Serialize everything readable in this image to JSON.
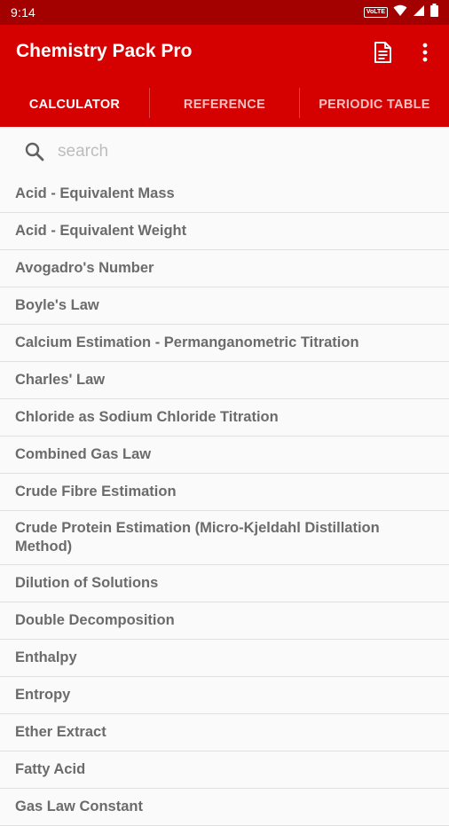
{
  "status_bar": {
    "time": "9:14",
    "volte": "VoLTE"
  },
  "app_bar": {
    "title": "Chemistry Pack Pro"
  },
  "tabs": [
    {
      "label": "CALCULATOR",
      "active": true
    },
    {
      "label": "REFERENCE",
      "active": false
    },
    {
      "label": "PERIODIC TABLE",
      "active": false
    }
  ],
  "search": {
    "placeholder": "search",
    "value": ""
  },
  "items": [
    "Acid - Equivalent Mass",
    "Acid - Equivalent Weight",
    "Avogadro's Number",
    "Boyle's Law",
    "Calcium Estimation - Permanganometric Titration",
    "Charles' Law",
    "Chloride as Sodium Chloride Titration",
    "Combined Gas Law",
    "Crude Fibre Estimation",
    "Crude Protein Estimation (Micro-Kjeldahl Distillation Method)",
    "Dilution of Solutions",
    "Double Decomposition",
    "Enthalpy",
    "Entropy",
    "Ether Extract",
    "Fatty Acid",
    "Gas Law Constant"
  ],
  "colors": {
    "status_bar": "#a30000",
    "app_bar": "#d50000",
    "item_text": "#6b6b6b",
    "divider": "#e0e0e0"
  },
  "icons": [
    "volte-badge",
    "wifi-icon",
    "signal-icon",
    "battery-icon",
    "document-icon",
    "more-vert-icon",
    "search-icon"
  ]
}
